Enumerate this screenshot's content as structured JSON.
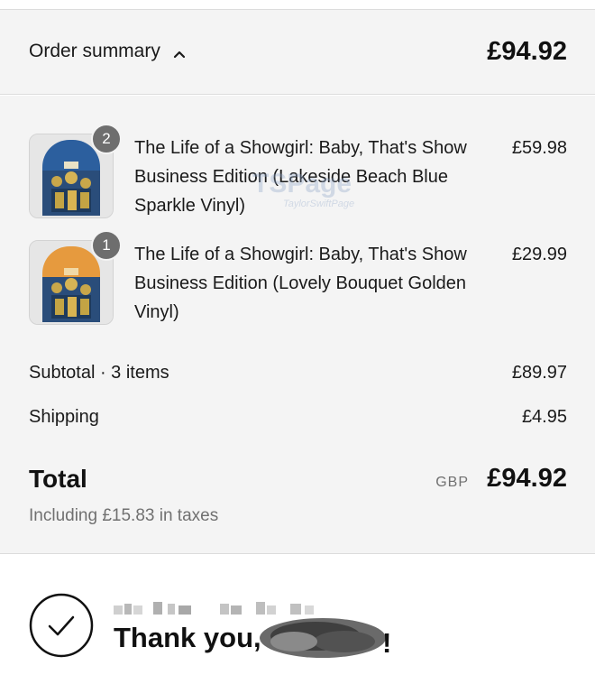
{
  "header": {
    "toggle_label": "Order summary",
    "total": "£94.92"
  },
  "items": [
    {
      "title": "The Life of a Showgirl: Baby, That's Show Business Edition (Lakeside Beach Blue Sparkle Vinyl)",
      "price": "£59.98",
      "quantity": "2",
      "accent": "#3a6fb0"
    },
    {
      "title": "The Life of a Showgirl: Baby, That's Show Business Edition (Lovely Bouquet Golden Vinyl)",
      "price": "£29.99",
      "quantity": "1",
      "accent": "#e8a14a"
    }
  ],
  "watermark": {
    "main": "TSPage",
    "sub": "TaylorSwiftPage"
  },
  "subtotal": {
    "label": "Subtotal · 3 items",
    "value": "£89.97"
  },
  "shipping": {
    "label": "Shipping",
    "value": "£4.95"
  },
  "total": {
    "label": "Total",
    "currency": "GBP",
    "value": "£94.92",
    "tax_note": "Including £15.83 in taxes"
  },
  "confirmation": {
    "thank_you": "Thank you,",
    "exclamation": "!"
  },
  "colors": {
    "panel_bg": "#f4f4f4",
    "text": "#1a1a1a",
    "muted": "#707070",
    "badge": "#6e6e6e"
  }
}
